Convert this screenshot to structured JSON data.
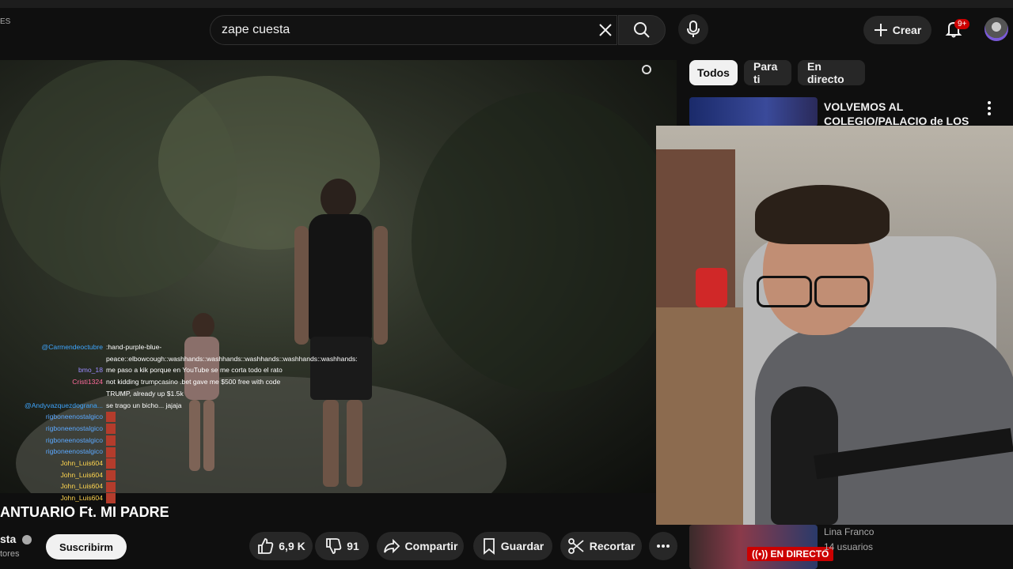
{
  "header": {
    "lang": "ES",
    "search_value": "zape cuesta",
    "create_label": "Crear",
    "notifications_badge": "9+"
  },
  "chat": [
    {
      "user": "@Carmendeoctubre",
      "color": "#3ea6ff",
      "msg": ":hand-purple-blue-peace::elbowcough::washhands::washhands::washhands::washhands::washhands:"
    },
    {
      "user": "bmo_18",
      "color": "#9b8cff",
      "msg": "me paso a kik porque en YouTube se me corta todo el rato"
    },
    {
      "user": "Cristi1324",
      "color": "#ff6b9d",
      "msg": "not kidding trumpcasino .bet gave me $500 free with code TRUMP, already up $1.5k"
    },
    {
      "user": "@Andyvazquezdograna...",
      "color": "#3ea6ff",
      "msg": "se trago un bicho... jajaja"
    },
    {
      "user": "rigboneenostalgico",
      "color": "#5ba8ff",
      "msg": ""
    },
    {
      "user": "rigboneenostalgico",
      "color": "#5ba8ff",
      "msg": ""
    },
    {
      "user": "rigboneenostalgico",
      "color": "#5ba8ff",
      "msg": ""
    },
    {
      "user": "rigboneenostalgico",
      "color": "#5ba8ff",
      "msg": ""
    },
    {
      "user": "John_Luis604",
      "color": "#ffd54f",
      "msg": ""
    },
    {
      "user": "John_Luis604",
      "color": "#ffd54f",
      "msg": ""
    },
    {
      "user": "John_Luis604",
      "color": "#ffd54f",
      "msg": ""
    },
    {
      "user": "John_Luis604",
      "color": "#ffd54f",
      "msg": ""
    }
  ],
  "video": {
    "title": "ANTUARIO Ft. MI PADRE",
    "channel": "sta",
    "subscribers": "tores",
    "subscribe_label": "Suscribirm"
  },
  "actions": {
    "likes": "6,9 K",
    "dislikes": "91",
    "share": "Compartir",
    "save": "Guardar",
    "clip": "Recortar"
  },
  "filters": [
    "Todos",
    "Para ti",
    "En directo"
  ],
  "recommendations": [
    {
      "title": "VOLVEMOS AL COLEGIO/PALACIO de LOS ..."
    },
    {
      "name": "Lina Franco",
      "users": "14 usuarios",
      "live_label": "EN DIRECTO"
    }
  ],
  "colors": {
    "accent": "#cc0000",
    "background": "#0f0f0f",
    "chip": "#272727"
  }
}
